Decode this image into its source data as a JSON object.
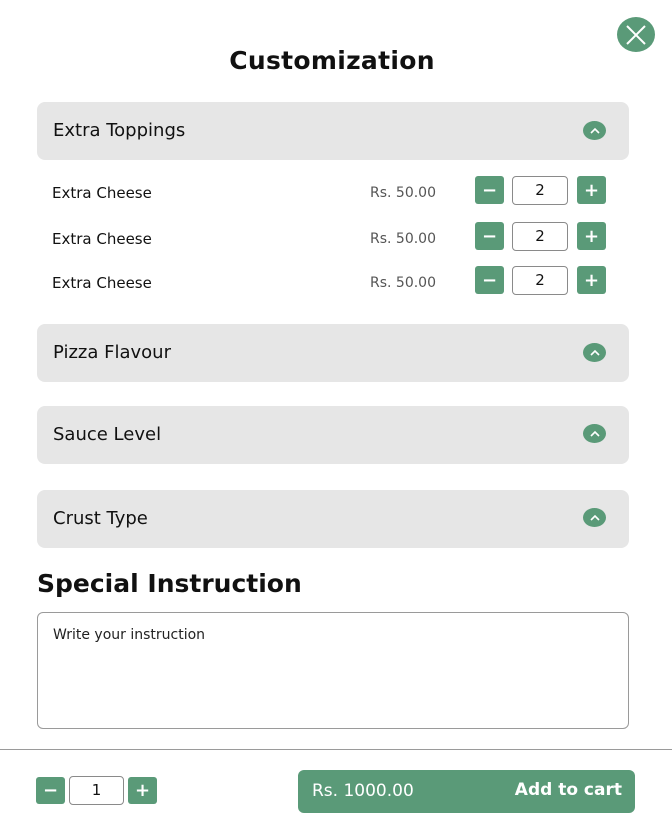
{
  "header": {
    "title": "Customization",
    "close_icon": "close-x-icon"
  },
  "colors": {
    "accent": "#5a9a78",
    "section_bg": "#e6e6e6"
  },
  "sections": [
    {
      "label": "Extra Toppings",
      "icon": "chevron-up-icon",
      "expanded": true,
      "items": [
        {
          "name": "Extra Cheese",
          "price": "Rs. 50.00",
          "quantity": "2",
          "minus": "−",
          "plus": "+"
        },
        {
          "name": "Extra Cheese",
          "price": "Rs. 50.00",
          "quantity": "2",
          "minus": "−",
          "plus": "+"
        },
        {
          "name": "Extra Cheese",
          "price": "Rs. 50.00",
          "quantity": "2",
          "minus": "−",
          "plus": "+"
        }
      ]
    },
    {
      "label": "Pizza Flavour",
      "icon": "chevron-up-icon",
      "expanded": false
    },
    {
      "label": "Sauce Level",
      "icon": "chevron-up-icon",
      "expanded": false
    },
    {
      "label": "Crust Type",
      "icon": "chevron-up-icon",
      "expanded": false
    }
  ],
  "special_instruction": {
    "heading": "Special Instruction",
    "placeholder": "Write your instruction",
    "value": ""
  },
  "footer": {
    "quantity": "1",
    "minus": "−",
    "plus": "+",
    "total": "Rs. 1000.00",
    "add_to_cart": "Add to cart"
  }
}
